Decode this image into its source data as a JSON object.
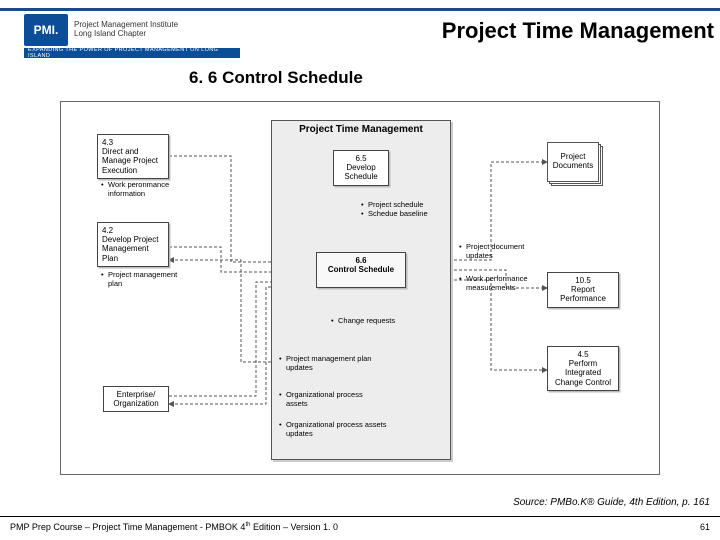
{
  "logo": {
    "mark": "PMI.",
    "line1": "Project Management Institute",
    "line2": "Long Island Chapter",
    "strap": "EXPANDING THE POWER OF PROJECT MANAGEMENT ON LONG ISLAND"
  },
  "title": "Project Time Management",
  "section": "6. 6 Control Schedule",
  "shade_title": "Project Time Management",
  "nodes": {
    "n43": {
      "num": "4.3",
      "name": "Direct and Manage Project Execution"
    },
    "n42": {
      "num": "4.2",
      "name": "Develop Project Management Plan"
    },
    "n65": {
      "num": "6.5",
      "name": "Develop Schedule"
    },
    "n66": {
      "num": "6.6",
      "name": "Control Schedule"
    },
    "n105": {
      "num": "10.5",
      "name": "Report Performance"
    },
    "n45": {
      "num": "4.5",
      "name": "Perform Integrated Change Control"
    },
    "ent": {
      "name": "Enterprise/ Organization"
    },
    "pdocs": {
      "name": "Project Documents"
    }
  },
  "bullets": {
    "b43": [
      "Work peronmance information"
    ],
    "b42": [
      "Project management plan"
    ],
    "b65": [
      "Project schedule",
      "Schedue baseline"
    ],
    "bpd": [
      "Project document updates"
    ],
    "bwp": [
      "Work performance measurements"
    ],
    "bcr": [
      "Change requests"
    ],
    "bpmu": [
      "Project management plan updates"
    ],
    "bopa": [
      "Organizational process assets"
    ],
    "bopau": [
      "Organizational process assets updates"
    ]
  },
  "source": "Source: PMBo.K® Guide, 4th Edition, p. 161",
  "footer_a": "PMP Prep Course – Project Time Management - PMBOK 4",
  "footer_b": " Edition – Version 1. 0",
  "footer_sup": "th",
  "pagenum": "61"
}
